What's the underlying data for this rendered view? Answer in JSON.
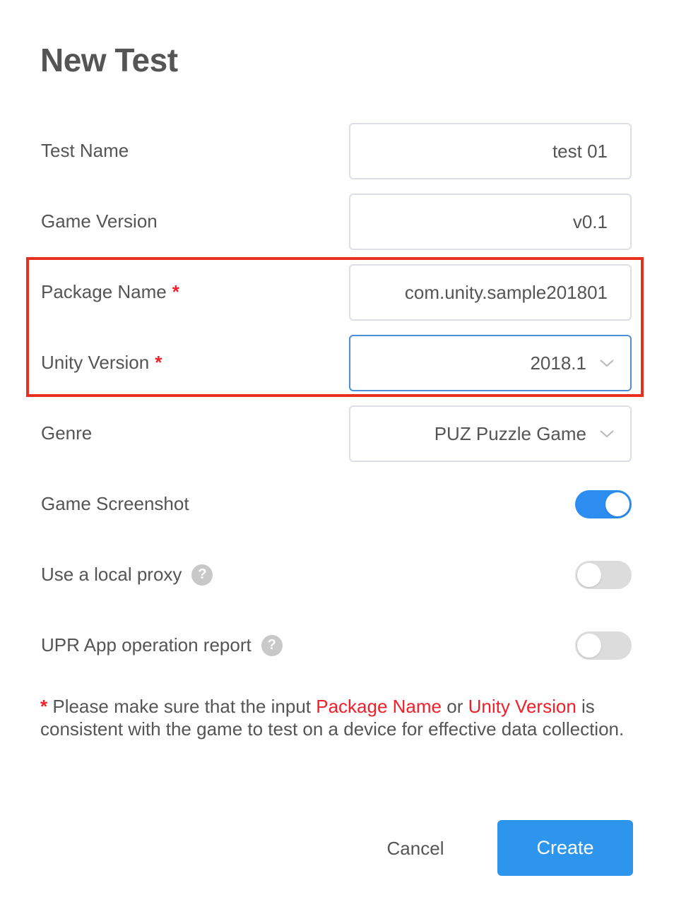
{
  "dialog": {
    "title": "New Test"
  },
  "form": {
    "test_name": {
      "label": "Test Name",
      "value": "test 01"
    },
    "game_version": {
      "label": "Game Version",
      "value": "v0.1"
    },
    "package_name": {
      "label": "Package Name",
      "required_mark": "*",
      "value": "com.unity.sample201801"
    },
    "unity_version": {
      "label": "Unity Version",
      "required_mark": "*",
      "selected": "2018.1",
      "icon": "chevron-down-icon"
    },
    "genre": {
      "label": "Genre",
      "selected": "PUZ Puzzle Game",
      "icon": "chevron-down-icon"
    },
    "game_screenshot": {
      "label": "Game Screenshot",
      "enabled": true
    },
    "local_proxy": {
      "label": "Use a local proxy",
      "help": "?",
      "enabled": false
    },
    "upr_report": {
      "label": "UPR App operation report",
      "help": "?",
      "enabled": false
    }
  },
  "note": {
    "star": "*",
    "part1": " Please make sure that the input ",
    "package_name": "Package Name",
    "part2": " or ",
    "unity_version": "Unity Version",
    "part3": " is consistent with the game to test on a device for effective data collection."
  },
  "buttons": {
    "cancel": "Cancel",
    "create": "Create"
  },
  "colors": {
    "primary": "#2d95ec",
    "toggle_on": "#2d8cf0",
    "required": "#f0202a",
    "highlight": "#e8301e",
    "text": "#555555"
  }
}
